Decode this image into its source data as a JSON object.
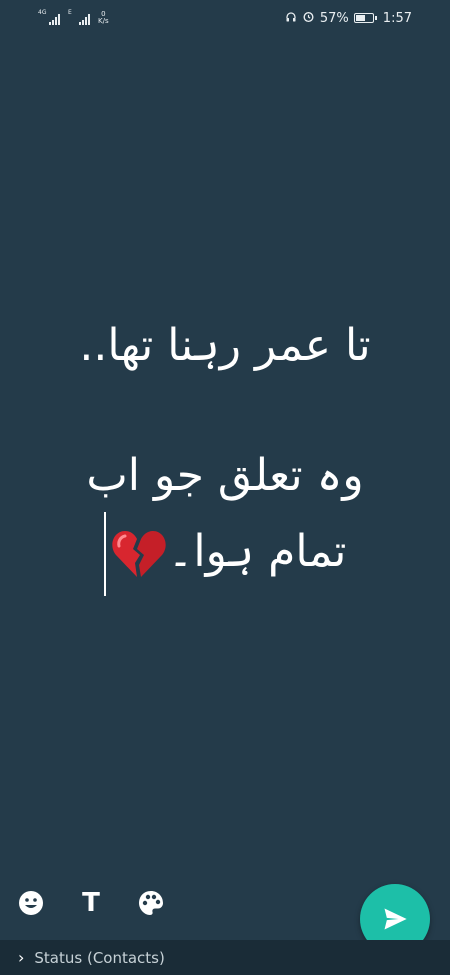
{
  "status_bar": {
    "network_left": "4G",
    "network_right": "E",
    "speed_value": "0",
    "speed_unit": "K/s",
    "battery_percent": "57%",
    "battery_level": 0.57,
    "time": "1:57"
  },
  "composer": {
    "line1": "تا عمر رہنا تھا..",
    "line2": "وہ تعلق جو اب",
    "line3": "تمام ہوا۔"
  },
  "bottom_bar": {
    "label": "Status (Contacts)"
  },
  "colors": {
    "background": "#243b4a",
    "accent": "#1dbfa8",
    "bottom_bar": "#1a2c37"
  }
}
